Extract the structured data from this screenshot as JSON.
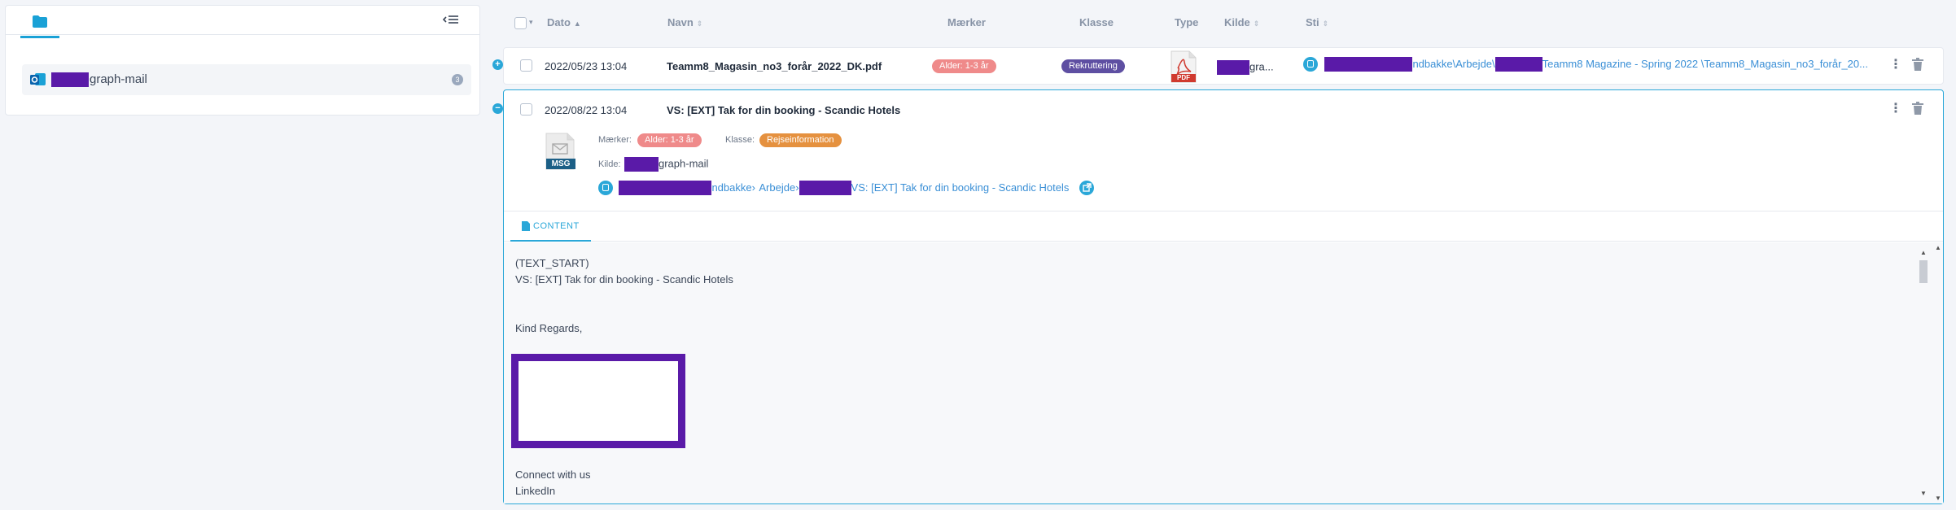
{
  "sidebar": {
    "source": {
      "name": "graph-mail",
      "count": "3"
    }
  },
  "header": {
    "date": "Dato",
    "name": "Navn",
    "tags": "Mærker",
    "class": "Klasse",
    "type": "Type",
    "source": "Kilde",
    "path": "Sti"
  },
  "rows": [
    {
      "date": "2022/05/23 13:04",
      "name": "Teamm8_Magasin_no3_forår_2022_DK.pdf",
      "tag": "Alder: 1-3 år",
      "class": "Rekruttering",
      "type_label": "PDF",
      "source": "gra...",
      "path_a": "ndbakke\\Arbejde\\",
      "path_b": "Teamm8 Magazine - Spring 2022 \\Teamm8_Magasin_no3_forår_20..."
    },
    {
      "date": "2022/08/22 13:04",
      "name": "VS: [EXT] Tak for din booking - Scandic Hotels",
      "type_label": "MSG",
      "tags_label": "Mærker:",
      "tag": "Alder: 1-3 år",
      "class_label": "Klasse:",
      "class": "Rejseinformation",
      "source_label": "Kilde:",
      "source": "graph-mail",
      "path_a": "ndbakke›",
      "path_b": "Arbejde›",
      "path_c": "VS: [EXT] Tak for din booking - Scandic Hotels"
    }
  ],
  "content": {
    "tab_label": "CONTENT",
    "lines": [
      "(TEXT_START)",
      "VS: [EXT] Tak for din booking - Scandic Hotels",
      "Kind Regards,",
      "Connect with us",
      "LinkedIn"
    ]
  },
  "colors": {
    "accent": "#2aa7d8",
    "redaction": "#5a1aa8"
  }
}
